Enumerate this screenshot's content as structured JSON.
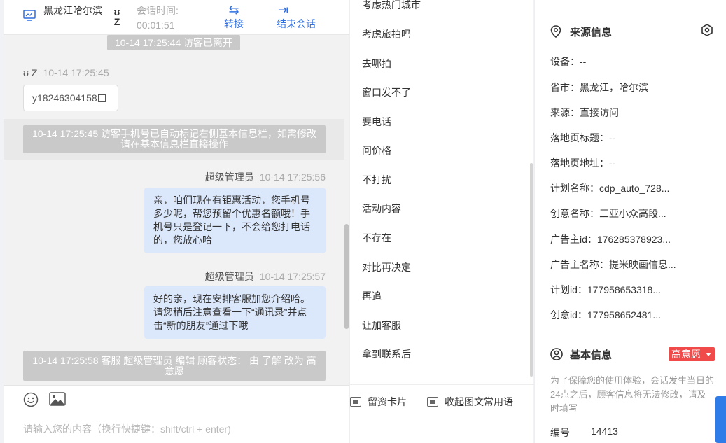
{
  "header": {
    "location": "黑龙江哈尔滨",
    "avatar_initials": "ʊ Z",
    "session_label": "会话时间:",
    "session_time": "00:01:51",
    "transfer_label": "转接",
    "end_label": "结束会话"
  },
  "chat": {
    "notice_visitor_left": "10-14 17:25:44 访客已离开",
    "visitor_name": "ʊ Z",
    "visitor_time": "10-14 17:25:45",
    "visitor_message": "y18246304158",
    "notice_phone_marked": "10-14 17:25:45 访客手机号已自动标记右侧基本信息栏，如需修改请在基本信息栏直接操作",
    "agent_name": "超级管理员",
    "agent_time_1": "10-14 17:25:56",
    "agent_message_1": "亲，咱们现在有钜惠活动，您手机号多少呢，帮您预留个优惠名额哦！手机号只是登记一下，不会给您打电话的，您放心哈",
    "agent_time_2": "10-14 17:25:57",
    "agent_message_2": "好的亲，现在安排客服加您介绍哈。请您稍后注意查看一下“通讯录”并点击“新的朋友”通过下哦",
    "notice_status_change": "10-14 17:25:58 客服 超级管理员 编辑 顾客状态： 由 了解 改为 高意愿"
  },
  "input": {
    "placeholder": "请输入您的内容（换行快捷键：shift/ctrl + enter)",
    "card_button": "留资卡片",
    "phrase_button": "收起图文常用语"
  },
  "quick_replies": [
    "考虑热门城市",
    "考虑旅拍吗",
    "去哪拍",
    "窗口发不了",
    "要电话",
    "问价格",
    "不打扰",
    "活动内容",
    "不存在",
    "对比再决定",
    "再追",
    "让加客服",
    "拿到联系后"
  ],
  "source_info": {
    "title": "来源信息",
    "rows": [
      "设备：--",
      "省市：黑龙江，哈尔滨",
      "来源：直接访问",
      "落地页标题：--",
      "落地页地址：--",
      "计划名称：cdp_auto_728...",
      "创意名称：三亚小众高段...",
      "广告主id：176285378923...",
      "广告主名称：提米映画信息...",
      "计划id：177958653318...",
      "创意id：177958652481..."
    ]
  },
  "basic_info": {
    "title": "基本信息",
    "intent_tag": "高意愿",
    "notice": "为了保障您的使用体验，会话发生当日的24点之后，顾客信息将无法修改，请及时填写",
    "id_label": "编号",
    "id_value": "14413"
  },
  "colors": {
    "accent": "#2f6fe0",
    "tag": "#f04a4a",
    "agent_bubble": "#dbe7fb"
  }
}
